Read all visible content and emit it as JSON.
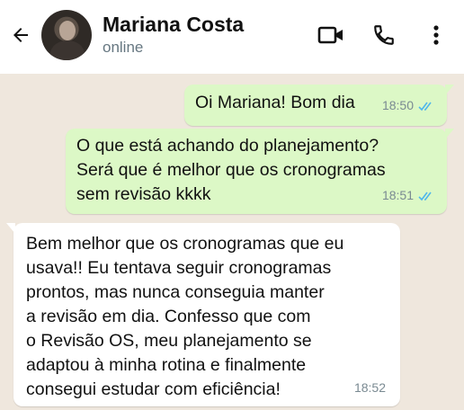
{
  "header": {
    "contact_name": "Mariana Costa",
    "status": "online",
    "back_icon": "arrow-left-icon",
    "video_icon": "video-camera-icon",
    "call_icon": "phone-icon",
    "menu_icon": "more-vertical-icon"
  },
  "colors": {
    "outgoing_bubble": "#dcf8c6",
    "incoming_bubble": "#ffffff",
    "read_ticks": "#4fb6ec",
    "chat_background": "#efe7dd"
  },
  "messages": [
    {
      "direction": "outgoing",
      "text": "Oi Mariana! Bom dia",
      "time": "18:50",
      "status": "read"
    },
    {
      "direction": "outgoing",
      "text": "O que está achando do planejamento?\nSerá que é melhor que os cronogramas\nsem revisão kkkk",
      "time": "18:51",
      "status": "read"
    },
    {
      "direction": "incoming",
      "text": "Bem melhor que os cronogramas que eu\nusava!! Eu tentava seguir cronogramas\nprontos, mas nunca conseguia manter\na revisão em dia. Confesso que com\no Revisão OS, meu planejamento se\nadaptou à minha rotina e finalmente\nconsegui estudar com eficiência!",
      "time": "18:52"
    }
  ]
}
